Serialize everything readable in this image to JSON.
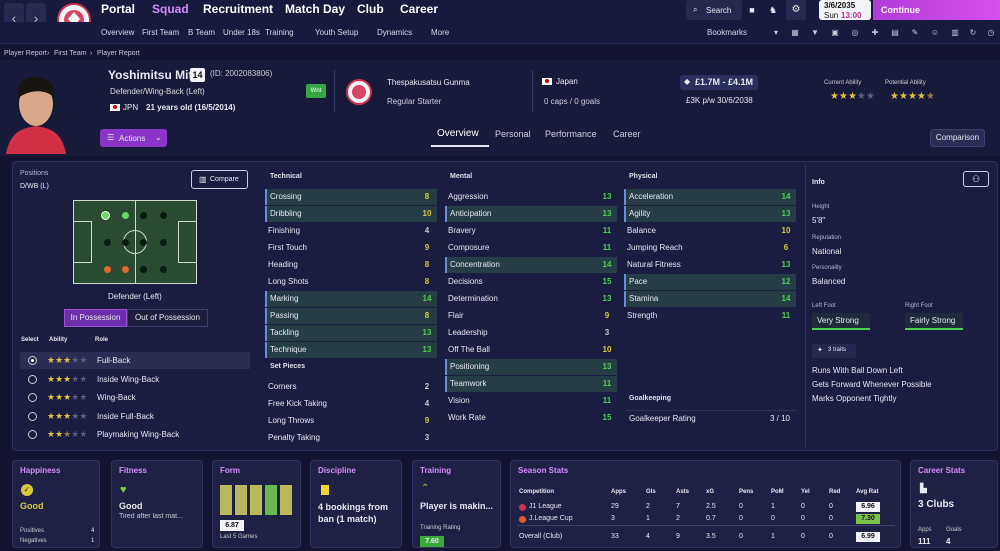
{
  "nav": {
    "back": "‹",
    "forward": "›",
    "items": [
      "Portal",
      "Squad",
      "Recruitment",
      "Match Day",
      "Club",
      "Career"
    ],
    "search": "Search",
    "date": "3/6/2035",
    "day": "Sun",
    "time": "13:00",
    "continue": "Continue"
  },
  "subnav": {
    "items": [
      "Overview",
      "First Team",
      "B Team",
      "Under 18s",
      "Training",
      "Youth Setup",
      "Dynamics",
      "More"
    ],
    "bookmarks": "Bookmarks"
  },
  "breadcrumb": [
    "Player Report",
    "First Team",
    "Player Report"
  ],
  "player": {
    "name": "Yoshimitsu Mito",
    "number": "14",
    "id": "(ID: 2002083806)",
    "position": "Defender/Wing-Back (Left)",
    "nation_code": "JPN",
    "age": "21 years old (16/5/2014)",
    "wnt": "Wnt",
    "club": "Thespakusatsu Gunma",
    "status": "Regular Starter",
    "country": "Japan",
    "caps": "0 caps / 0 goals",
    "value": "£1.7M - £4.1M",
    "wage": "£3K p/w 30/6/2038",
    "current_ability_label": "Current Ability",
    "potential_ability_label": "Potential Ability",
    "current_ability_stars": 3,
    "potential_ability_stars": 4.5,
    "actions": "Actions"
  },
  "tabs": [
    "Overview",
    "Personal",
    "Performance",
    "Career"
  ],
  "comparison": "Comparison",
  "positions": {
    "label": "Positions",
    "value": "D/WB (L)",
    "compare": "Compare",
    "role_position": "Defender (Left)",
    "in_possession": "In Possession",
    "out_possession": "Out of Possession",
    "headers": [
      "Select",
      "Ability",
      "Role"
    ],
    "roles": [
      {
        "name": "Full-Back",
        "stars": 3,
        "selected": true
      },
      {
        "name": "Inside Wing-Back",
        "stars": 3,
        "selected": false
      },
      {
        "name": "Wing-Back",
        "stars": 3,
        "selected": false
      },
      {
        "name": "Inside Full-Back",
        "stars": 3,
        "selected": false
      },
      {
        "name": "Playmaking Wing-Back",
        "stars": 2.5,
        "selected": false
      }
    ]
  },
  "technical": {
    "title": "Technical",
    "rows": [
      [
        "Crossing",
        "8"
      ],
      [
        "Dribbling",
        "10"
      ],
      [
        "Finishing",
        "4"
      ],
      [
        "First Touch",
        "9"
      ],
      [
        "Heading",
        "8"
      ],
      [
        "Long Shots",
        "8"
      ],
      [
        "Marking",
        "14"
      ],
      [
        "Passing",
        "8"
      ],
      [
        "Tackling",
        "13"
      ],
      [
        "Technique",
        "13"
      ]
    ]
  },
  "set_pieces": {
    "title": "Set Pieces",
    "rows": [
      [
        "Corners",
        "2"
      ],
      [
        "Free Kick Taking",
        "4"
      ],
      [
        "Long Throws",
        "9"
      ],
      [
        "Penalty Taking",
        "3"
      ]
    ]
  },
  "mental": {
    "title": "Mental",
    "rows": [
      [
        "Aggression",
        "13"
      ],
      [
        "Anticipation",
        "13"
      ],
      [
        "Bravery",
        "11"
      ],
      [
        "Composure",
        "11"
      ],
      [
        "Concentration",
        "14"
      ],
      [
        "Decisions",
        "15"
      ],
      [
        "Determination",
        "13"
      ],
      [
        "Flair",
        "9"
      ],
      [
        "Leadership",
        "3"
      ],
      [
        "Off The Ball",
        "10"
      ],
      [
        "Positioning",
        "13"
      ],
      [
        "Teamwork",
        "11"
      ],
      [
        "Vision",
        "11"
      ],
      [
        "Work Rate",
        "15"
      ]
    ]
  },
  "physical": {
    "title": "Physical",
    "rows": [
      [
        "Acceleration",
        "14"
      ],
      [
        "Agility",
        "13"
      ],
      [
        "Balance",
        "10"
      ],
      [
        "Jumping Reach",
        "6"
      ],
      [
        "Natural Fitness",
        "13"
      ],
      [
        "Pace",
        "12"
      ],
      [
        "Stamina",
        "14"
      ],
      [
        "Strength",
        "11"
      ]
    ]
  },
  "goalkeeping": {
    "title": "Goalkeeping",
    "rating_label": "Goalkeeper Rating",
    "rating": "3 / 10"
  },
  "info": {
    "title": "Info",
    "height_label": "Height",
    "height": "5'8\"",
    "reputation_label": "Reputation",
    "reputation": "National",
    "personality_label": "Personality",
    "personality": "Balanced",
    "left_foot_label": "Left Foot",
    "left_foot": "Very Strong",
    "right_foot_label": "Right Foot",
    "right_foot": "Fairly Strong",
    "traits_button": "3 traits",
    "traits": [
      "Runs With Ball Down Left",
      "Gets Forward Whenever Possible",
      "Marks Opponent Tightly"
    ]
  },
  "happiness": {
    "title": "Happiness",
    "value": "Good",
    "positives_label": "Positives",
    "positives": "4",
    "negatives_label": "Negatives",
    "negatives": "1"
  },
  "fitness": {
    "title": "Fitness",
    "value": "Good",
    "detail": "Tired after last mat..."
  },
  "form": {
    "title": "Form",
    "rating": "6.87",
    "label": "Last 5 Games"
  },
  "discipline": {
    "title": "Discipline",
    "value": "4 bookings from ban (1 match)"
  },
  "training": {
    "title": "Training",
    "value": "Player is makin...",
    "rating_label": "Training Rating",
    "rating": "7.60"
  },
  "season": {
    "title": "Season Stats",
    "headers": [
      "Competition",
      "Apps",
      "Gls",
      "Asts",
      "xG",
      "Pens",
      "PoM",
      "Yel",
      "Red",
      "Avg Rat"
    ],
    "rows": [
      [
        "J1 League",
        "29",
        "2",
        "7",
        "2.5",
        "0",
        "1",
        "0",
        "0",
        "6.96"
      ],
      [
        "J.League Cup",
        "3",
        "1",
        "2",
        "0.7",
        "0",
        "0",
        "0",
        "0",
        "7.30"
      ],
      [
        "Overall (Club)",
        "33",
        "4",
        "9",
        "3.5",
        "0",
        "1",
        "0",
        "0",
        "6.99"
      ]
    ]
  },
  "career": {
    "title": "Career Stats",
    "clubs": "3 Clubs",
    "apps_label": "Apps",
    "apps": "111",
    "goals_label": "Goals",
    "goals": "4"
  },
  "colors": {
    "accent": "#c94ef0",
    "panel": "#1a1d40",
    "green": "#4fcf4f"
  }
}
